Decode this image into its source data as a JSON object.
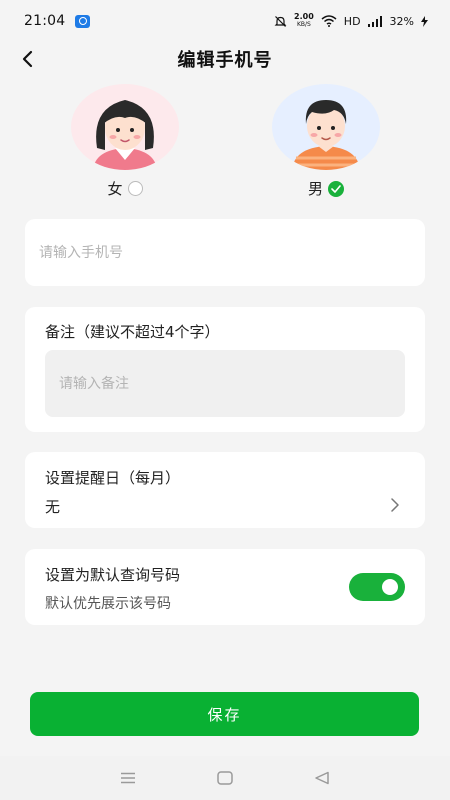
{
  "status_bar": {
    "time": "21:04",
    "net_speed_value": "2.00",
    "net_speed_unit": "KB/S",
    "network_label": "HD",
    "signal_type": "5G",
    "battery": "32%"
  },
  "header": {
    "title": "编辑手机号"
  },
  "gender": {
    "female_label": "女",
    "male_label": "男",
    "selected": "male"
  },
  "phone": {
    "placeholder": "请输入手机号",
    "value": ""
  },
  "note": {
    "title": "备注（建议不超过4个字）",
    "placeholder": "请输入备注",
    "value": ""
  },
  "reminder": {
    "title": "设置提醒日（每月）",
    "value": "无"
  },
  "default_number": {
    "title": "设置为默认查询号码",
    "subtitle": "默认优先展示该号码",
    "enabled": true
  },
  "save_button_label": "保存",
  "colors": {
    "accent_green": "#09b133",
    "page_bg": "#f4f4f4",
    "card_bg": "#ffffff"
  },
  "icons": {
    "back": "chevron-left-icon",
    "chevron": "chevron-right-icon",
    "selected": "check-circle-icon",
    "unselected": "radio-circle-icon",
    "nav_menu": "menu-icon",
    "nav_home": "square-icon",
    "nav_back": "triangle-back-icon"
  }
}
